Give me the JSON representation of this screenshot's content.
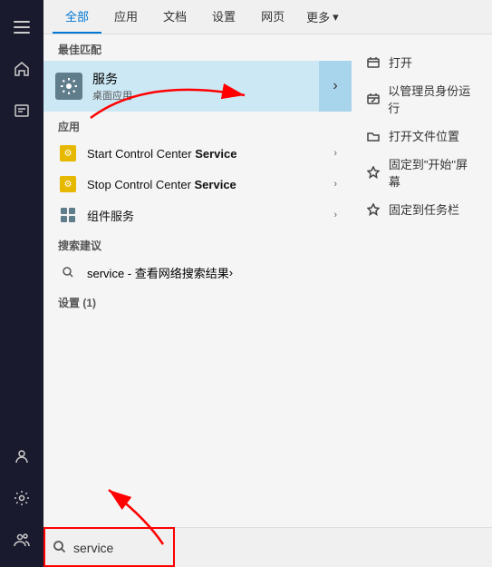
{
  "tabs": {
    "items": [
      {
        "label": "全部",
        "active": true
      },
      {
        "label": "应用",
        "active": false
      },
      {
        "label": "文档",
        "active": false
      },
      {
        "label": "设置",
        "active": false
      },
      {
        "label": "网页",
        "active": false
      },
      {
        "label": "更多",
        "active": false
      }
    ]
  },
  "sections": {
    "best_match": {
      "header": "最佳匹配",
      "item": {
        "title": "服务",
        "subtitle": "桌面应用",
        "arrow": "→"
      }
    },
    "apps": {
      "header": "应用",
      "items": [
        {
          "label_before": "Start Control Center ",
          "label_bold": "Service",
          "has_chevron": true
        },
        {
          "label_before": "Stop Control Center ",
          "label_bold": "Service",
          "has_chevron": true
        },
        {
          "label_before": "",
          "label_bold": "",
          "label_plain": "组件服务",
          "has_chevron": true
        }
      ]
    },
    "suggestions": {
      "header": "搜索建议",
      "item": {
        "text_before": "service",
        "text_after": " - 查看网络搜索结果",
        "has_chevron": true
      }
    },
    "settings": {
      "header": "设置 (1)"
    }
  },
  "right_panel": {
    "actions": [
      {
        "icon": "open",
        "label": "打开"
      },
      {
        "icon": "admin",
        "label": "以管理员身份运行"
      },
      {
        "icon": "folder",
        "label": "打开文件位置"
      },
      {
        "icon": "pin-start",
        "label": "固定到\"开始\"屏幕"
      },
      {
        "icon": "pin-taskbar",
        "label": "固定到任务栏"
      }
    ]
  },
  "search_bar": {
    "placeholder": "service",
    "icon": "🔍"
  },
  "sidebar": {
    "icons": [
      {
        "name": "menu",
        "symbol": "☰"
      },
      {
        "name": "home",
        "symbol": "⌂"
      },
      {
        "name": "user",
        "symbol": "👤"
      }
    ],
    "bottom_icons": [
      {
        "name": "person",
        "symbol": "👤"
      },
      {
        "name": "settings",
        "symbol": "⚙"
      },
      {
        "name": "user-circle",
        "symbol": "👥"
      }
    ]
  }
}
